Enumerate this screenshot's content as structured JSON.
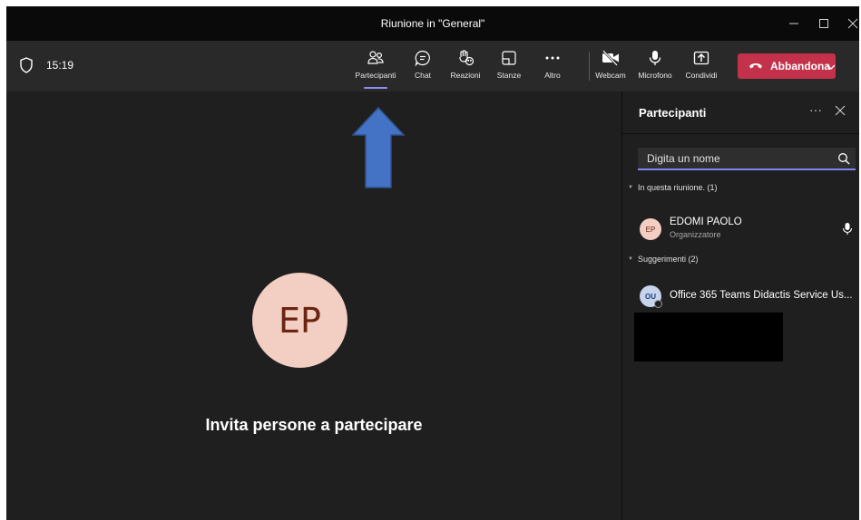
{
  "window": {
    "title": "Riunione in \"General\"",
    "controls": [
      "minimize-icon",
      "maximize-icon",
      "close-icon"
    ]
  },
  "toolbar": {
    "time": "15:19",
    "buttons": [
      {
        "id": "partecipanti",
        "label": "Partecipanti",
        "icon": "people-icon",
        "active": true
      },
      {
        "id": "chat",
        "label": "Chat",
        "icon": "chat-icon"
      },
      {
        "id": "reazioni",
        "label": "Reazioni",
        "icon": "reactions-icon"
      },
      {
        "id": "stanze",
        "label": "Stanze",
        "icon": "rooms-icon"
      },
      {
        "id": "altro",
        "label": "Altro",
        "icon": "more-icon"
      },
      {
        "id": "webcam",
        "label": "Webcam",
        "icon": "camera-off-icon"
      },
      {
        "id": "microfono",
        "label": "Microfono",
        "icon": "microphone-icon"
      },
      {
        "id": "condividi",
        "label": "Condividi",
        "icon": "share-icon"
      }
    ],
    "leave_label": "Abbandona"
  },
  "stage": {
    "avatar_initials": "EP",
    "avatar_color": "#f2cec3",
    "invite_text": "Invita persone a partecipare"
  },
  "panel": {
    "title": "Partecipanti",
    "search_placeholder": "Digita un nome",
    "sections": [
      {
        "label": "In questa riunione. (1)",
        "people": [
          {
            "initials": "EP",
            "name": "EDOMI PAOLO",
            "role": "Organizzatore",
            "mic": true
          }
        ]
      },
      {
        "label": "Suggerimenti (2)",
        "people": [
          {
            "initials": "OU",
            "name": "Office 365 Teams Didactis Service Us..."
          }
        ]
      }
    ]
  },
  "colors": {
    "accent": "#7f85f5",
    "leave": "#c4314b",
    "arrow": "#4472c4"
  }
}
